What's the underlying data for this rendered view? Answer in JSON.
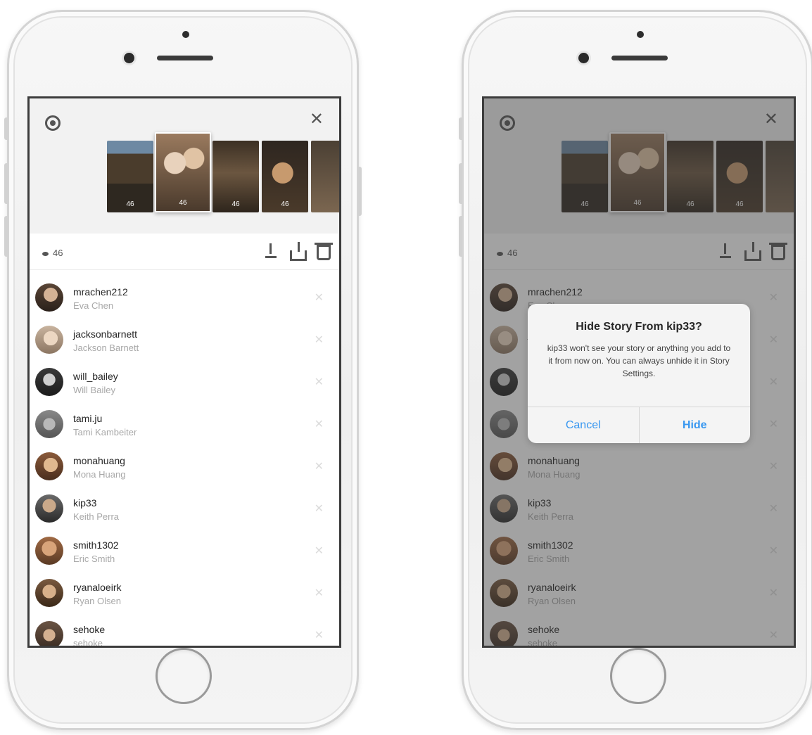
{
  "story_viewer": {
    "viewer_count": "46",
    "thumb_views": [
      "46",
      "46",
      "46",
      "46"
    ],
    "viewers": [
      {
        "username": "mrachen212",
        "full_name": "Eva Chen"
      },
      {
        "username": "jacksonbarnett",
        "full_name": "Jackson Barnett"
      },
      {
        "username": "will_bailey",
        "full_name": "Will Bailey"
      },
      {
        "username": "tami.ju",
        "full_name": "Tami Kambeiter"
      },
      {
        "username": "monahuang",
        "full_name": "Mona Huang"
      },
      {
        "username": "kip33",
        "full_name": "Keith Perra"
      },
      {
        "username": "smith1302",
        "full_name": "Eric Smith"
      },
      {
        "username": "ryanaloeirk",
        "full_name": "Ryan Olsen"
      },
      {
        "username": "sehoke",
        "full_name": "sehoke"
      }
    ]
  },
  "dialog": {
    "title": "Hide Story From kip33?",
    "message": "kip33 won't see your story or anything you add to it from now on. You can always unhide it in Story Settings.",
    "cancel_label": "Cancel",
    "hide_label": "Hide"
  },
  "icons": {
    "settings": "gear-icon",
    "close": "close-icon",
    "download": "download-icon",
    "share": "share-icon",
    "delete": "trash-icon",
    "remove": "x-icon",
    "views": "eye-icon"
  },
  "colors": {
    "accent": "#3897f0",
    "username": "#262626",
    "fullname": "#a8a8a8"
  }
}
